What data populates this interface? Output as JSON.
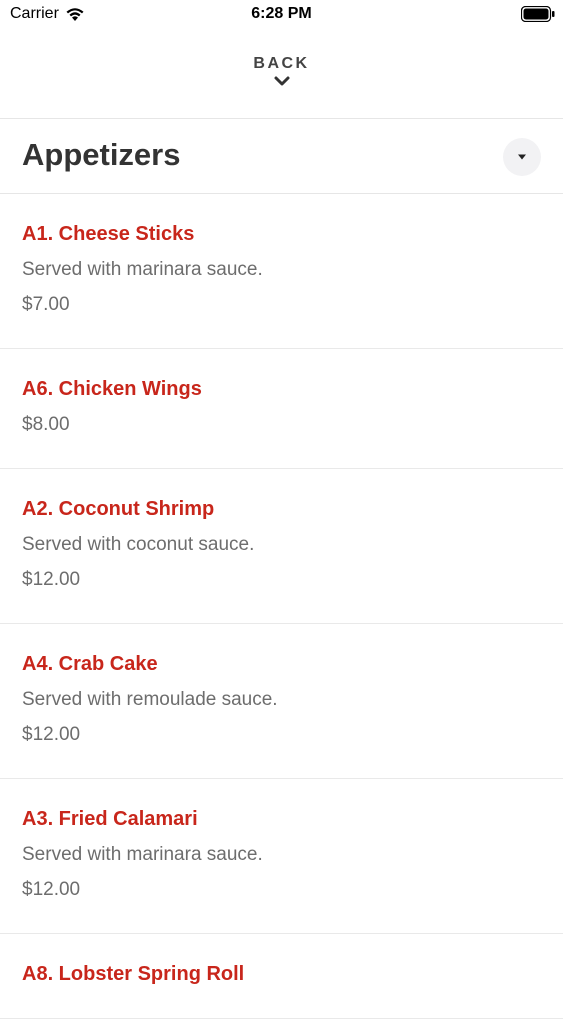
{
  "status_bar": {
    "carrier": "Carrier",
    "time": "6:28 PM"
  },
  "header": {
    "back_label": "BACK"
  },
  "section": {
    "title": "Appetizers"
  },
  "items": [
    {
      "name": "A1. Cheese Sticks",
      "description": "Served with marinara sauce.",
      "price": "$7.00"
    },
    {
      "name": "A6. Chicken Wings",
      "description": "",
      "price": "$8.00"
    },
    {
      "name": "A2. Coconut Shrimp",
      "description": "Served with coconut sauce.",
      "price": "$12.00"
    },
    {
      "name": "A4. Crab Cake",
      "description": "Served with remoulade sauce.",
      "price": "$12.00"
    },
    {
      "name": "A3. Fried Calamari",
      "description": "Served with marinara sauce.",
      "price": "$12.00"
    },
    {
      "name": "A8. Lobster Spring Roll",
      "description": "",
      "price": ""
    }
  ],
  "colors": {
    "item_name": "#c8261b",
    "text_muted": "#6d6d6d",
    "title": "#333333"
  },
  "icons": {
    "wifi": "wifi-icon",
    "battery": "battery-icon",
    "back": "chevron-down-icon",
    "collapse": "caret-down-icon"
  }
}
